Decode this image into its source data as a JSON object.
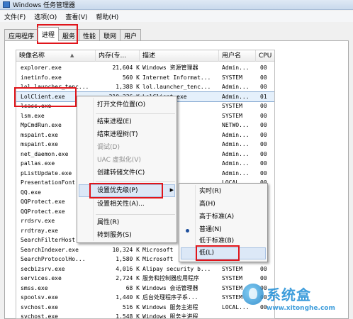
{
  "window": {
    "title": "Windows 任务管理器"
  },
  "menubar": {
    "items": [
      "文件(F)",
      "选项(O)",
      "查看(V)",
      "帮助(H)"
    ]
  },
  "tabs": [
    {
      "label": "应用程序",
      "active": false
    },
    {
      "label": "进程",
      "active": true
    },
    {
      "label": "服务",
      "active": false
    },
    {
      "label": "性能",
      "active": false
    },
    {
      "label": "联网",
      "active": false
    },
    {
      "label": "用户",
      "active": false
    }
  ],
  "table": {
    "headers": [
      "映像名称",
      "内存(专...",
      "描述",
      "用户名",
      "CPU"
    ],
    "rows": [
      {
        "name": "explorer.exe",
        "mem": "21,604 K",
        "desc": "Windows 资源管理器",
        "user": "Admin...",
        "cpu": "00"
      },
      {
        "name": "inetinfo.exe",
        "mem": "560 K",
        "desc": "Internet Informat...",
        "user": "SYSTEM",
        "cpu": "00"
      },
      {
        "name": "lol.launcher_tenc...",
        "mem": "1,388 K",
        "desc": "lol.launcher_tenc...",
        "user": "Admin...",
        "cpu": "00"
      },
      {
        "name": "LolClient.exe",
        "mem": "210,336 K",
        "desc": "LolClient.exe",
        "user": "Admin...",
        "cpu": "01",
        "selected": true
      },
      {
        "name": "lsass.exe",
        "mem": "",
        "desc": "rity Au...",
        "user": "SYSTEM",
        "cpu": "00"
      },
      {
        "name": "lsm.exe",
        "mem": "",
        "desc": "器服务",
        "user": "SYSTEM",
        "cpu": "00"
      },
      {
        "name": "MpCmdRun.exe",
        "mem": "",
        "desc": "alware...",
        "user": "NETWO...",
        "cpu": "00"
      },
      {
        "name": "mspaint.exe",
        "mem": "",
        "desc": "",
        "user": "Admin...",
        "cpu": "00"
      },
      {
        "name": "mspaint.exe",
        "mem": "",
        "desc": "",
        "user": "Admin...",
        "cpu": "00"
      },
      {
        "name": "net_daemon.exe",
        "mem": "",
        "desc": "和发...",
        "user": "Admin...",
        "cpu": "00"
      },
      {
        "name": "pallas.exe",
        "mem": "",
        "desc": "Pallas",
        "user": "Admin...",
        "cpu": "00"
      },
      {
        "name": "pListUpdate.exe",
        "mem": "",
        "desc": "e",
        "user": "Admin...",
        "cpu": "00"
      },
      {
        "name": "PresentationFont...",
        "mem": "",
        "desc": "",
        "user": "LOCAL...",
        "cpu": "00"
      },
      {
        "name": "QQ.exe",
        "mem": "",
        "desc": "",
        "user": "",
        "cpu": ""
      },
      {
        "name": "QQProtect.exe",
        "mem": "",
        "desc": "",
        "user": "",
        "cpu": ""
      },
      {
        "name": "QQProtect.exe",
        "mem": "",
        "desc": "",
        "user": "",
        "cpu": ""
      },
      {
        "name": "rrdsrv.exe",
        "mem": "",
        "desc": "",
        "user": "",
        "cpu": ""
      },
      {
        "name": "rrdtray.exe",
        "mem": "",
        "desc": "",
        "user": "",
        "cpu": ""
      },
      {
        "name": "SearchFilterHost...",
        "mem": "",
        "desc": "",
        "user": "",
        "cpu": ""
      },
      {
        "name": "SearchIndexer.exe",
        "mem": "10,324 K",
        "desc": "Microsoft",
        "user": "",
        "cpu": ""
      },
      {
        "name": "SearchProtocolHo...",
        "mem": "1,580 K",
        "desc": "Microsoft",
        "user": "",
        "cpu": ""
      },
      {
        "name": "secbizsrv.exe",
        "mem": "4,016 K",
        "desc": "Alipay security b...",
        "user": "SYSTEM",
        "cpu": "00"
      },
      {
        "name": "services.exe",
        "mem": "2,724 K",
        "desc": "服务和控制器应用程序",
        "user": "SYSTEM",
        "cpu": "00"
      },
      {
        "name": "smss.exe",
        "mem": "68 K",
        "desc": "Windows 会话管理器",
        "user": "SYSTEM",
        "cpu": "00"
      },
      {
        "name": "spoolsv.exe",
        "mem": "1,440 K",
        "desc": "后台处理程序子系...",
        "user": "SYSTEM",
        "cpu": "00"
      },
      {
        "name": "svchost.exe",
        "mem": "516 K",
        "desc": "Windows 服务主进程",
        "user": "LOCAL...",
        "cpu": "00"
      },
      {
        "name": "svchost.exe",
        "mem": "1,548 K",
        "desc": "Windows 服务主进程",
        "user": "",
        "cpu": ""
      }
    ]
  },
  "context_menu": {
    "items": [
      {
        "label": "打开文件位置(O)",
        "disabled": false
      },
      {
        "label": "结束进程(E)",
        "disabled": false
      },
      {
        "label": "结束进程树(T)",
        "disabled": false
      },
      {
        "label": "调试(D)",
        "disabled": true
      },
      {
        "label": "UAC 虚拟化(V)",
        "disabled": true
      },
      {
        "label": "创建转储文件(C)",
        "disabled": false
      },
      {
        "label": "设置优先级(P)",
        "disabled": false,
        "highlighted": true
      },
      {
        "label": "设置相关性(A)...",
        "disabled": false
      },
      {
        "label": "属性(R)",
        "disabled": false
      },
      {
        "label": "转到服务(S)",
        "disabled": false
      }
    ]
  },
  "priority_submenu": {
    "items": [
      {
        "label": "实时(R)",
        "checked": false
      },
      {
        "label": "高(H)",
        "checked": false
      },
      {
        "label": "高于标准(A)",
        "checked": false
      },
      {
        "label": "普通(N)",
        "checked": true
      },
      {
        "label": "低于标准(B)",
        "checked": false
      },
      {
        "label": "低(L)",
        "checked": false,
        "highlighted": true
      }
    ]
  },
  "watermark": {
    "title": "系统盒",
    "url": "www.xitonghe.com"
  },
  "colors": {
    "highlight_box": "#e0151b",
    "selection": "#e5f0fb",
    "menu_hover": "#dce8f7"
  }
}
